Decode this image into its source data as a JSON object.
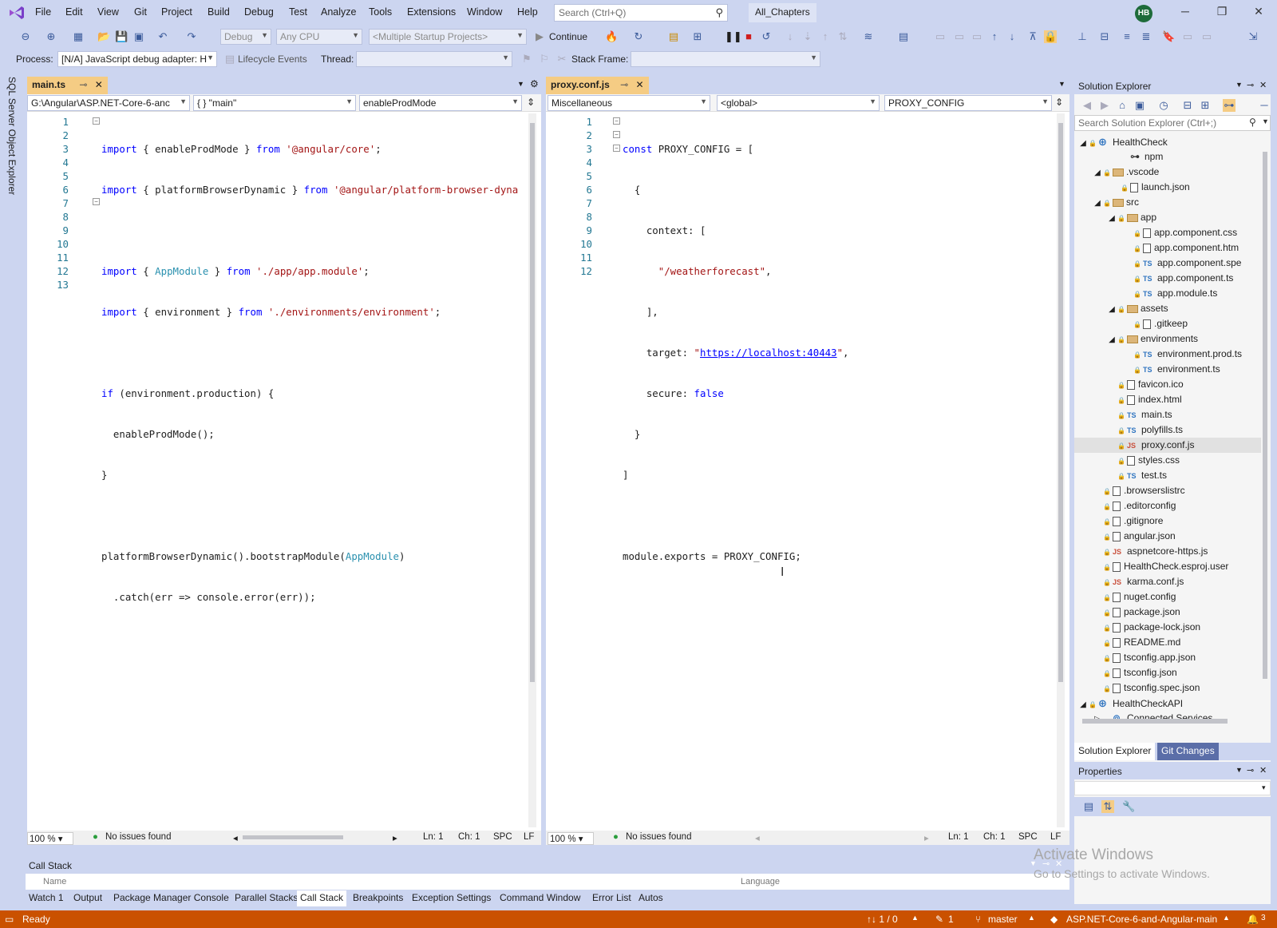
{
  "menu": [
    "File",
    "Edit",
    "View",
    "Git",
    "Project",
    "Build",
    "Debug",
    "Test",
    "Analyze",
    "Tools",
    "Extensions",
    "Window",
    "Help"
  ],
  "search": {
    "placeholder": "Search (Ctrl+Q)"
  },
  "solution_name": "All_Chapters",
  "user_initials": "HB",
  "toolbar": {
    "config": "Debug",
    "platform": "Any CPU",
    "startup": "<Multiple Startup Projects>",
    "continue": "Continue"
  },
  "debug_location": {
    "process_label": "Process:",
    "process_value": "[N/A] JavaScript debug adapter: H",
    "lifecycle": "Lifecycle Events",
    "thread_label": "Thread:",
    "stack_frame_label": "Stack Frame:"
  },
  "side_tab": "SQL Server Object Explorer",
  "left_editor": {
    "tab": "main.ts",
    "nav": [
      "G:\\Angular\\ASP.NET-Core-6-anc",
      "{ } \"main\"",
      "enableProdMode"
    ],
    "line_numbers": [
      "1",
      "2",
      "3",
      "4",
      "5",
      "6",
      "7",
      "8",
      "9",
      "10",
      "11",
      "12",
      "13"
    ],
    "zoom": "100 %",
    "issues": "No issues found",
    "ln": "Ln: 1",
    "ch": "Ch: 1",
    "spc": "SPC",
    "lf": "LF"
  },
  "right_editor": {
    "tab": "proxy.conf.js",
    "nav": [
      "Miscellaneous",
      "<global>",
      "PROXY_CONFIG"
    ],
    "line_numbers": [
      "1",
      "2",
      "3",
      "4",
      "5",
      "6",
      "7",
      "8",
      "9",
      "10",
      "11",
      "12"
    ],
    "zoom": "100 %",
    "issues": "No issues found",
    "ln": "Ln: 1",
    "ch": "Ch: 1",
    "spc": "SPC",
    "lf": "LF"
  },
  "code_left": [
    "import { enableProdMode } from '@angular/core';",
    "import { platformBrowserDynamic } from '@angular/platform-browser-dyna",
    "",
    "import { AppModule } from './app/app.module';",
    "import { environment } from './environments/environment';",
    "",
    "if (environment.production) {",
    "  enableProdMode();",
    "}",
    "",
    "platformBrowserDynamic().bootstrapModule(AppModule)",
    "  .catch(err => console.error(err));",
    ""
  ],
  "code_right": [
    "const PROXY_CONFIG = [",
    "  {",
    "    context: [",
    "      \"/weatherforecast\",",
    "    ],",
    "    target: \"https://localhost:40443\",",
    "    secure: false",
    "  }",
    "]",
    "",
    "module.exports = PROXY_CONFIG;",
    ""
  ],
  "solution_explorer": {
    "title": "Solution Explorer",
    "search_placeholder": "Search Solution Explorer (Ctrl+;)",
    "items": [
      {
        "label": "HealthCheck",
        "icon": "project-icon"
      },
      {
        "label": "npm",
        "icon": "npm-icon"
      },
      {
        "label": ".vscode",
        "icon": "folder-icon"
      },
      {
        "label": "launch.json",
        "icon": "json-file-icon"
      },
      {
        "label": "src",
        "icon": "folder-icon"
      },
      {
        "label": "app",
        "icon": "folder-icon"
      },
      {
        "label": "app.component.css",
        "icon": "css-file-icon"
      },
      {
        "label": "app.component.htm",
        "icon": "html-file-icon"
      },
      {
        "label": "app.component.spe",
        "icon": "ts-file-icon"
      },
      {
        "label": "app.component.ts",
        "icon": "ts-file-icon"
      },
      {
        "label": "app.module.ts",
        "icon": "ts-file-icon"
      },
      {
        "label": "assets",
        "icon": "folder-icon"
      },
      {
        "label": ".gitkeep",
        "icon": "file-icon"
      },
      {
        "label": "environments",
        "icon": "folder-icon"
      },
      {
        "label": "environment.prod.ts",
        "icon": "ts-file-icon"
      },
      {
        "label": "environment.ts",
        "icon": "ts-file-icon"
      },
      {
        "label": "favicon.ico",
        "icon": "file-icon"
      },
      {
        "label": "index.html",
        "icon": "html-file-icon"
      },
      {
        "label": "main.ts",
        "icon": "ts-file-icon"
      },
      {
        "label": "polyfills.ts",
        "icon": "ts-file-icon"
      },
      {
        "label": "proxy.conf.js",
        "icon": "js-file-icon"
      },
      {
        "label": "styles.css",
        "icon": "css-file-icon"
      },
      {
        "label": "test.ts",
        "icon": "ts-file-icon"
      },
      {
        "label": ".browserslistrc",
        "icon": "file-icon"
      },
      {
        "label": ".editorconfig",
        "icon": "file-icon"
      },
      {
        "label": ".gitignore",
        "icon": "file-icon"
      },
      {
        "label": "angular.json",
        "icon": "json-file-icon"
      },
      {
        "label": "aspnetcore-https.js",
        "icon": "js-file-icon"
      },
      {
        "label": "HealthCheck.esproj.user",
        "icon": "file-icon"
      },
      {
        "label": "karma.conf.js",
        "icon": "js-file-icon"
      },
      {
        "label": "nuget.config",
        "icon": "config-file-icon"
      },
      {
        "label": "package.json",
        "icon": "json-file-icon"
      },
      {
        "label": "package-lock.json",
        "icon": "json-file-icon"
      },
      {
        "label": "README.md",
        "icon": "md-file-icon"
      },
      {
        "label": "tsconfig.app.json",
        "icon": "json-file-icon"
      },
      {
        "label": "tsconfig.json",
        "icon": "json-file-icon"
      },
      {
        "label": "tsconfig.spec.json",
        "icon": "json-file-icon"
      },
      {
        "label": "HealthCheckAPI",
        "icon": "project-icon"
      },
      {
        "label": "Connected Services",
        "icon": "connected-services-icon"
      }
    ],
    "tabs": [
      "Solution Explorer",
      "Git Changes"
    ]
  },
  "properties": {
    "title": "Properties"
  },
  "call_stack": {
    "title": "Call Stack",
    "columns": [
      "Name",
      "Language"
    ]
  },
  "bottom_tabs": [
    "Watch 1",
    "Output",
    "Package Manager Console",
    "Parallel Stacks",
    "Call Stack",
    "Breakpoints",
    "Exception Settings",
    "Command Window",
    "Error List",
    "Autos"
  ],
  "watermark": {
    "line1": "Activate Windows",
    "line2": "Go to Settings to activate Windows."
  },
  "status": {
    "ready": "Ready",
    "sync": "↑↓ 1 / 0",
    "pending": "1",
    "branch": "master",
    "repo": "ASP.NET-Core-6-and-Angular-main",
    "notifications": "3"
  },
  "colors": {
    "status_bar": "#ca5100",
    "chrome": "#ccd5f0",
    "active_tab": "#f5cc84"
  }
}
